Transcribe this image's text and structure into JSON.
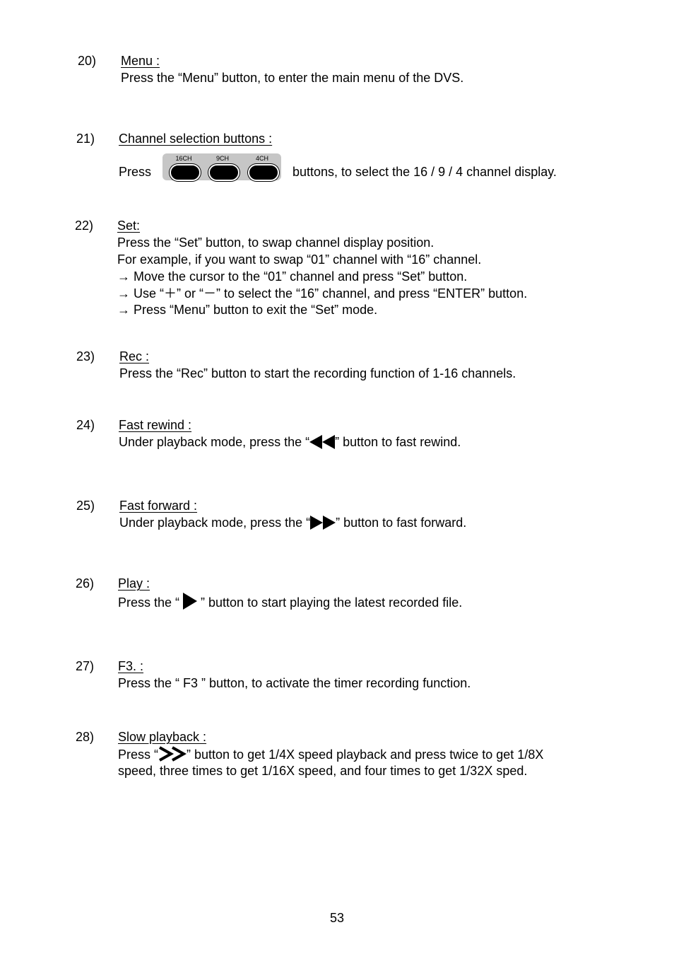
{
  "items": [
    {
      "num": "20)",
      "title": "Menu :",
      "lines": [
        "Press the “Menu” button, to enter the main menu of the DVS."
      ]
    },
    {
      "num": "21)",
      "title": "Channel selection buttons :",
      "prefix": "Press",
      "suffix": "buttons, to select the 16 / 9 / 4 channel display.",
      "channel_buttons": [
        "16CH",
        "9CH",
        "4CH"
      ]
    },
    {
      "num": "22)",
      "title": "Set:",
      "lines": [
        "Press the “Set” button, to swap channel display position.",
        "For example, if you want to swap “01” channel with “16” channel.",
        "→ Move the cursor to the “01” channel and press “Set” button.",
        "→ Use “＋” or  “－” to select the “16” channel, and press “ENTER” button.",
        "→ Press “Menu” button to exit the “Set” mode."
      ]
    },
    {
      "num": "23)",
      "title": "Rec :",
      "lines": [
        "Press the “Rec” button to start the recording function of 1-16 channels."
      ]
    },
    {
      "num": "24)",
      "title": "Fast rewind :",
      "before": "Under playback mode, press the “",
      "after": "” button to fast rewind.",
      "icon": "fast-rewind-icon"
    },
    {
      "num": "25)",
      "title": "Fast forward :",
      "before": "Under playback mode, press the “",
      "after": "” button to fast forward.",
      "icon": "fast-forward-icon"
    },
    {
      "num": "26)",
      "title": "Play :",
      "before": "Press the “ ",
      "after": " ” button to start playing the latest recorded file.",
      "icon": "play-icon"
    },
    {
      "num": "27)",
      "title": "F3. :",
      "lines": [
        "Press the “ F3  ” button, to activate the timer recording function."
      ]
    },
    {
      "num": "28)",
      "title": "Slow playback :",
      "before": "Press “",
      "after": "” button to get 1/4X speed playback and press twice to get 1/8X",
      "line2": "speed, three times to get 1/16X speed, and four times to get 1/32X sped.",
      "icon": "slow-playback-icon"
    }
  ],
  "page_number": "53"
}
